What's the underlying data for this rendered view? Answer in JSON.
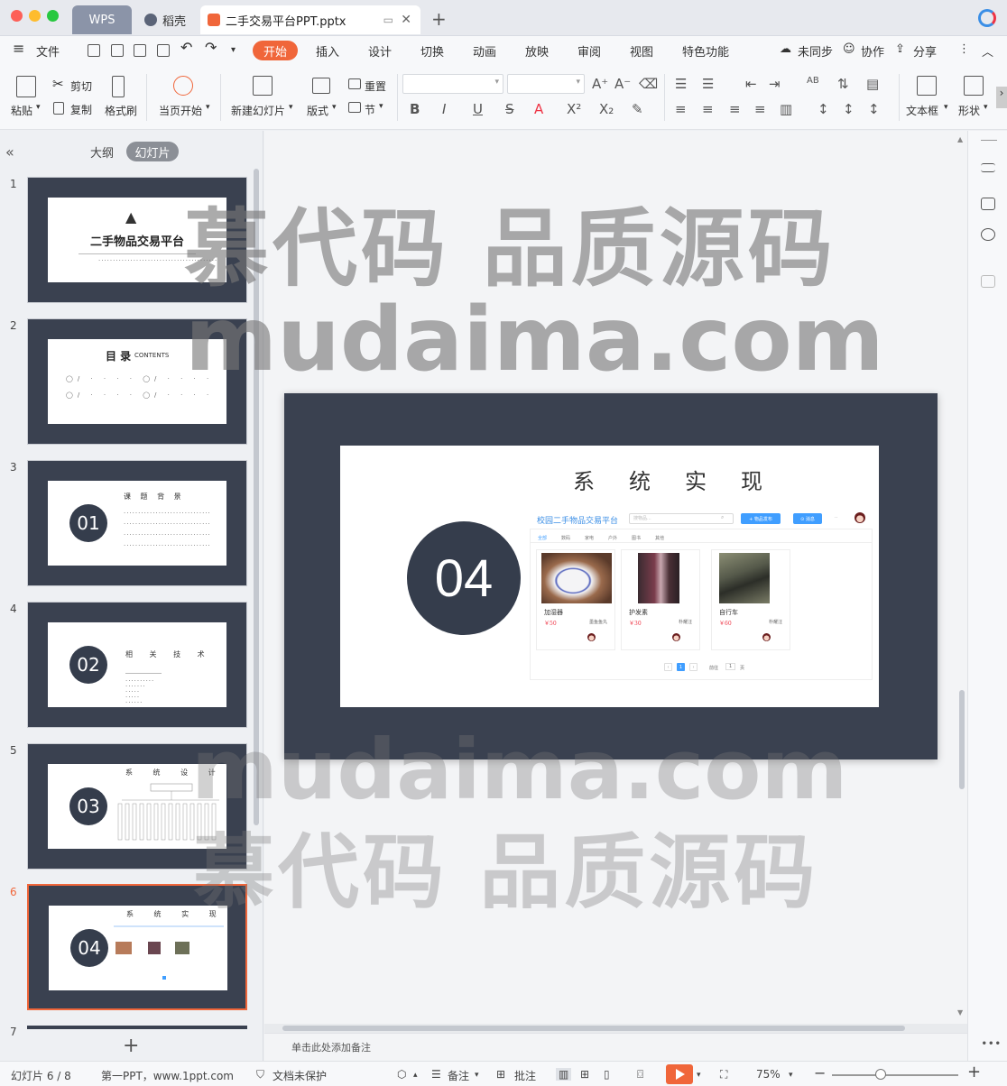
{
  "titlebar": {
    "tabs": [
      {
        "label": "WPS"
      },
      {
        "label": "稻壳"
      },
      {
        "label": "二手交易平台PPT.pptx"
      }
    ]
  },
  "menubar": {
    "file": "文件",
    "tabs": [
      "开始",
      "插入",
      "设计",
      "切换",
      "动画",
      "放映",
      "审阅",
      "视图",
      "特色功能"
    ],
    "sync": "未同步",
    "collab": "协作",
    "share": "分享"
  },
  "ribbon": {
    "paste": "粘贴",
    "cut": "剪切",
    "copy": "复制",
    "format_painter": "格式刷",
    "from_current": "当页开始",
    "new_slide": "新建幻灯片",
    "layout": "版式",
    "reset": "重置",
    "section": "节",
    "textbox": "文本框",
    "shape": "形状"
  },
  "left_panel": {
    "outline_tab": "大纲",
    "slides_tab": "幻灯片",
    "slides": [
      {
        "num": "1",
        "title": "二手物品交易平台"
      },
      {
        "num": "2",
        "title": "目 录",
        "subtitle": "CONTENTS"
      },
      {
        "num": "3",
        "circle": "01",
        "title": "课 题 背 景"
      },
      {
        "num": "4",
        "circle": "02",
        "title": "相 关 技 术"
      },
      {
        "num": "5",
        "circle": "03",
        "title": "系 统 设 计"
      },
      {
        "num": "6",
        "circle": "04",
        "title": "系 统 实 现"
      },
      {
        "num": "7"
      }
    ]
  },
  "slide": {
    "number": "04",
    "title": "系统实现",
    "site": {
      "brand": "校园二手物品交易平台",
      "search_placeholder": "搜物品...",
      "publish_btn": "+ 物品发布",
      "message_btn": "⊙ 消息",
      "nav": [
        "全部",
        "数码",
        "家电",
        "户外",
        "图书",
        "其他"
      ],
      "items": [
        {
          "name": "加湿器",
          "price": "￥50",
          "seller": "墨鱼鱼丸"
        },
        {
          "name": "护发素",
          "price": "￥30",
          "seller": "朴耀汪"
        },
        {
          "name": "自行车",
          "price": "￥60",
          "seller": "朴耀汪"
        }
      ],
      "current_page": "1",
      "goto_label": "前往",
      "goto_value": "1",
      "page_unit": "页"
    }
  },
  "notes": {
    "placeholder": "单击此处添加备注"
  },
  "statusbar": {
    "slide_counter": "幻灯片 6 / 8",
    "template": "第一PPT，www.1ppt.com",
    "protection": "文档未保护",
    "notes_btn": "备注",
    "comment_btn": "批注",
    "zoom": "75%"
  },
  "watermark": {
    "line_cn": "慕代码 品质源码",
    "line_en": "mudaima.com"
  }
}
